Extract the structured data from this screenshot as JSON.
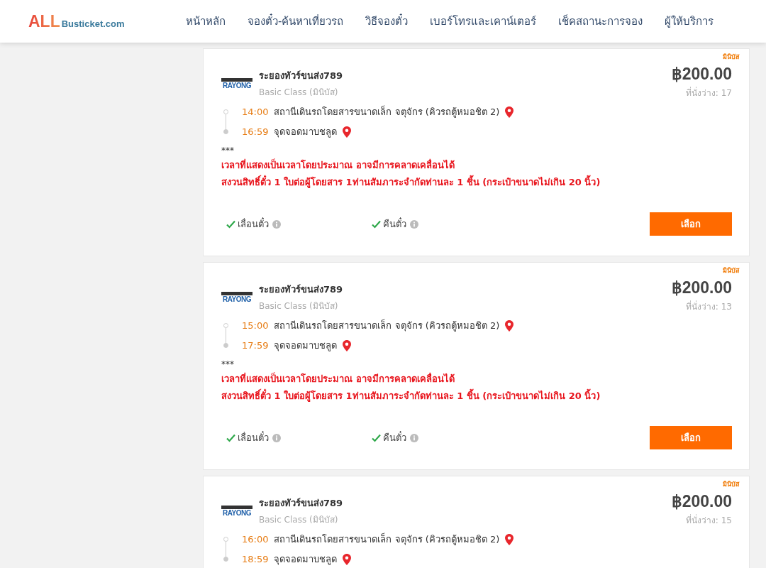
{
  "header": {
    "logo": {
      "main": "ALL",
      "sub": "Busticket.com"
    },
    "nav": [
      {
        "label": "หน้าหลัก"
      },
      {
        "label": "จองตั๋ว-ค้นหาเที่ยวรถ"
      },
      {
        "label": "วิธีจองตั๋ว"
      },
      {
        "label": "เบอร์โทรและเคาน์เตอร์"
      },
      {
        "label": "เช็คสถานะการจอง"
      },
      {
        "label": "ผู้ให้บริการ"
      }
    ]
  },
  "trips": [
    {
      "badge": "มินิบัส",
      "logo": "RAYONG",
      "operator": "ระยองทัวร์ขนส่ง789",
      "class": "Basic Class (มินิบัส)",
      "price": "฿200.00",
      "seats": "ที่นั่งว่าง: 17",
      "stops": [
        {
          "time": "14:00",
          "place": "สถานีเดินรถโดยสารขนาดเล็ก จตุจักร (คิวรถตู้หมอชิต 2)"
        },
        {
          "time": "16:59",
          "place": "จุดจอดมาบชลูด"
        }
      ],
      "note_mark": "***",
      "notes": [
        "เวลาที่แสดงเป็นเวลาโดยประมาณ อาจมีการคลาดเคลื่อนได้",
        "สงวนสิทธิ์ตั๋ว 1 ใบต่อผู้โดยสาร 1ท่านสัมภาระจำกัดท่านละ 1 ชิ้น (กระเป๋าขนาดไม่เกิน 20 นิ้ว)"
      ],
      "features": [
        {
          "label": "เลื่อนตั๋ว",
          "available": true
        },
        {
          "label": "คืนตั๋ว",
          "available": true
        }
      ],
      "button": "เลือก"
    },
    {
      "badge": "มินิบัส",
      "logo": "RAYONG",
      "operator": "ระยองทัวร์ขนส่ง789",
      "class": "Basic Class (มินิบัส)",
      "price": "฿200.00",
      "seats": "ที่นั่งว่าง: 13",
      "stops": [
        {
          "time": "15:00",
          "place": "สถานีเดินรถโดยสารขนาดเล็ก จตุจักร (คิวรถตู้หมอชิต 2)"
        },
        {
          "time": "17:59",
          "place": "จุดจอดมาบชลูด"
        }
      ],
      "note_mark": "***",
      "notes": [
        "เวลาที่แสดงเป็นเวลาโดยประมาณ อาจมีการคลาดเคลื่อนได้",
        "สงวนสิทธิ์ตั๋ว 1 ใบต่อผู้โดยสาร 1ท่านสัมภาระจำกัดท่านละ 1 ชิ้น (กระเป๋าขนาดไม่เกิน 20 นิ้ว)"
      ],
      "features": [
        {
          "label": "เลื่อนตั๋ว",
          "available": true
        },
        {
          "label": "คืนตั๋ว",
          "available": true
        }
      ],
      "button": "เลือก"
    },
    {
      "badge": "มินิบัส",
      "logo": "RAYONG",
      "operator": "ระยองทัวร์ขนส่ง789",
      "class": "Basic Class (มินิบัส)",
      "price": "฿200.00",
      "seats": "ที่นั่งว่าง: 15",
      "stops": [
        {
          "time": "16:00",
          "place": "สถานีเดินรถโดยสารขนาดเล็ก จตุจักร (คิวรถตู้หมอชิต 2)"
        },
        {
          "time": "18:59",
          "place": "จุดจอดมาบชลูด"
        }
      ]
    }
  ]
}
